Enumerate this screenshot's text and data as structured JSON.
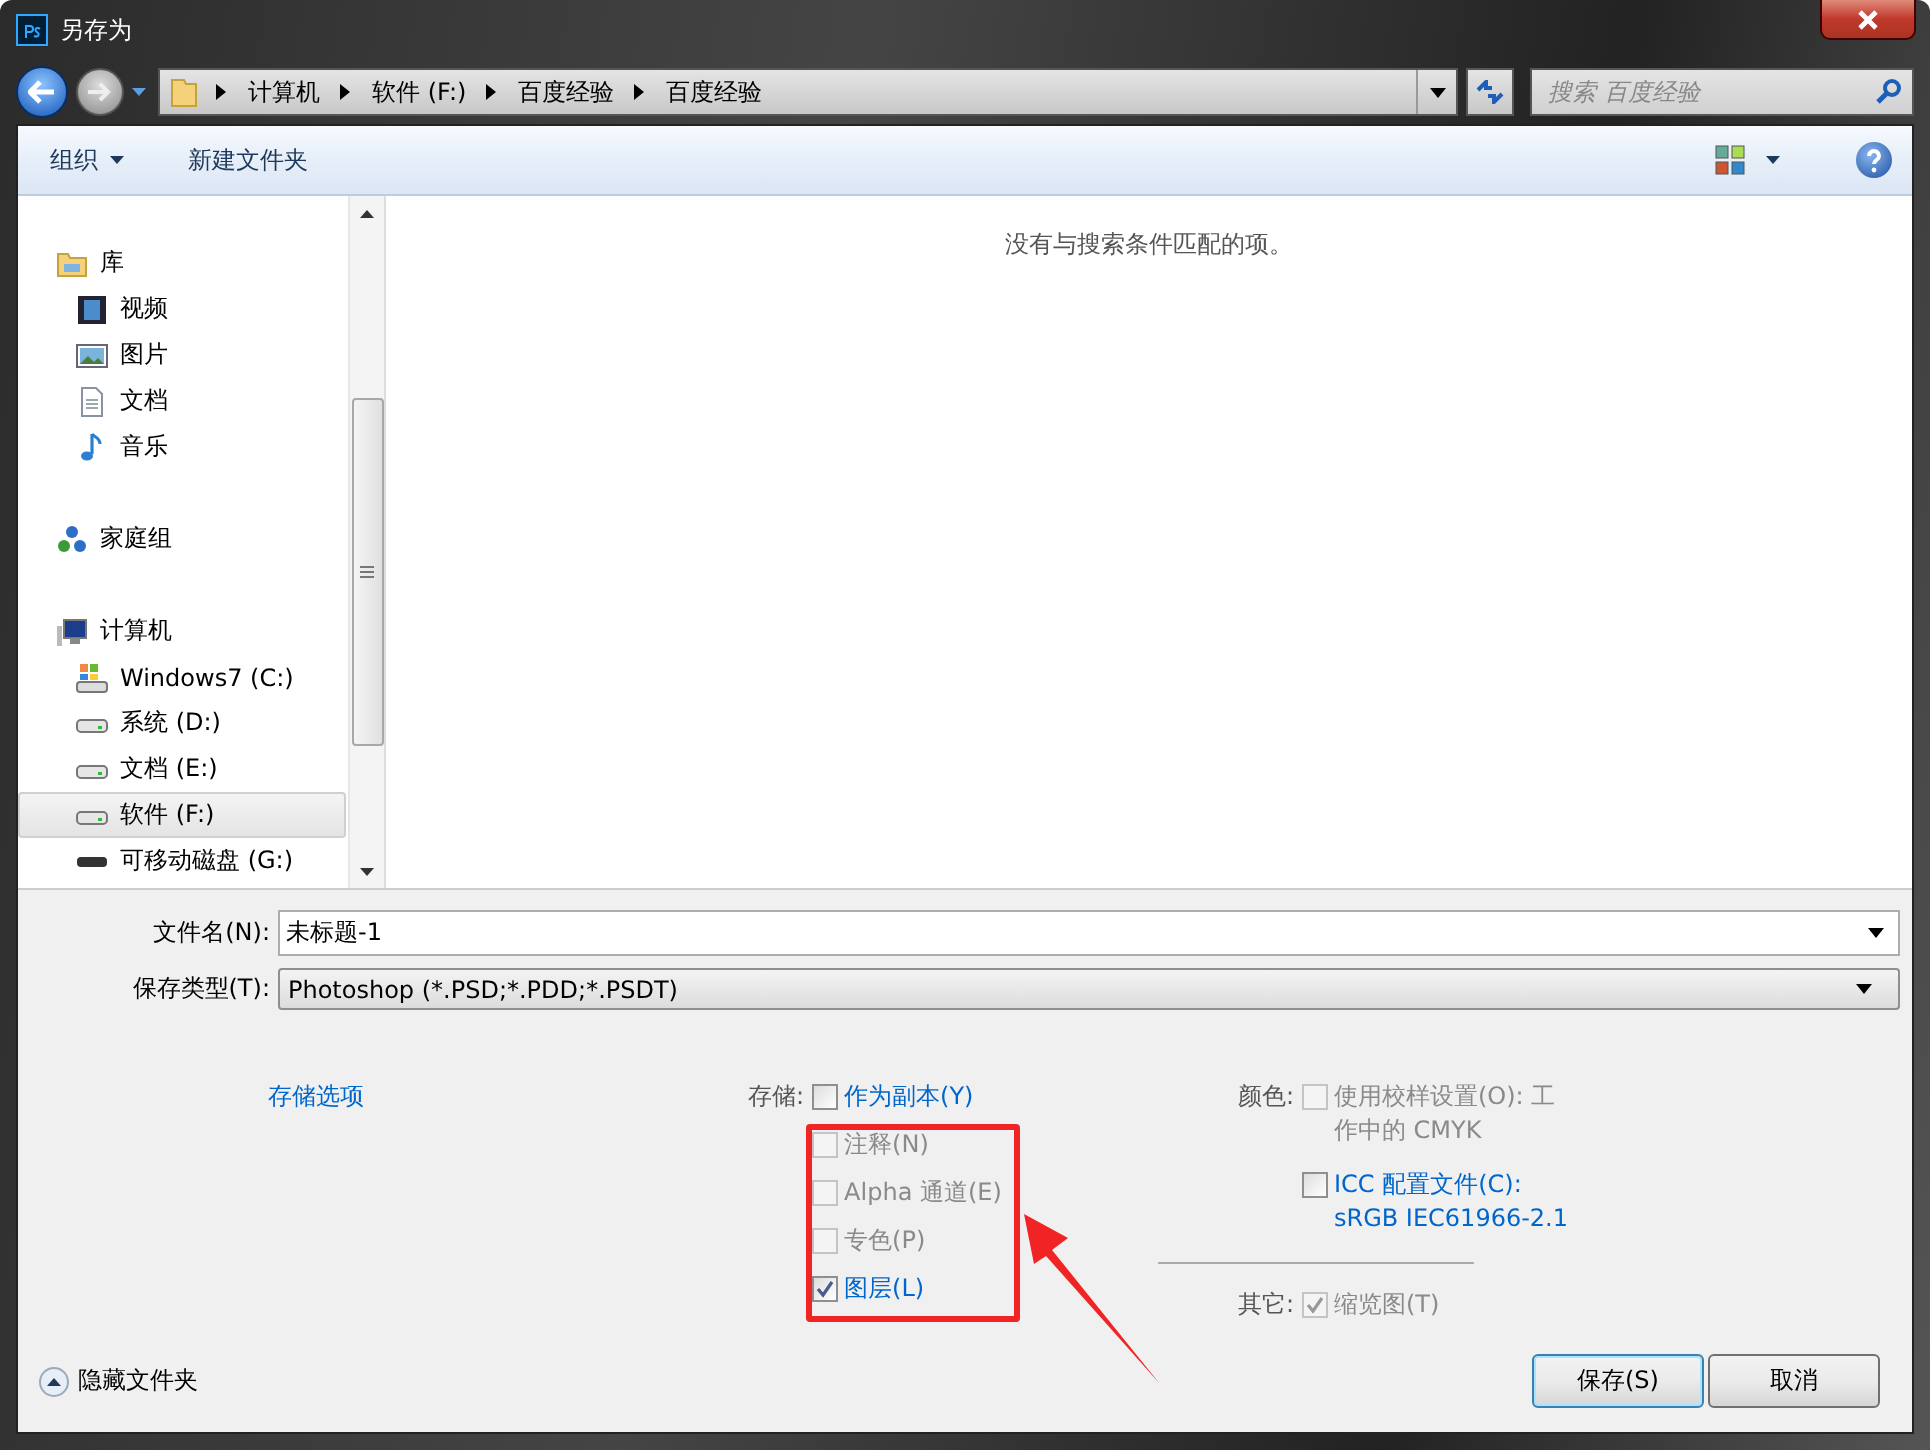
{
  "window": {
    "title": "另存为"
  },
  "breadcrumb": [
    "计算机",
    "软件 (F:)",
    "百度经验",
    "百度经验"
  ],
  "search": {
    "placeholder": "搜索 百度经验"
  },
  "toolbar": {
    "organize": "组织",
    "new_folder": "新建文件夹"
  },
  "sidebar": {
    "items": [
      {
        "label": "库",
        "kind": "library",
        "selected": false,
        "children": [
          {
            "label": "视频",
            "kind": "video",
            "selected": false
          },
          {
            "label": "图片",
            "kind": "pictures",
            "selected": false
          },
          {
            "label": "文档",
            "kind": "document",
            "selected": false
          },
          {
            "label": "音乐",
            "kind": "music",
            "selected": false
          }
        ]
      },
      {
        "label": "家庭组",
        "kind": "homegroup",
        "selected": false
      },
      {
        "label": "计算机",
        "kind": "computer",
        "selected": false,
        "children": [
          {
            "label": "Windows7 (C:)",
            "kind": "system-drive",
            "selected": false
          },
          {
            "label": "系统 (D:)",
            "kind": "drive",
            "selected": false
          },
          {
            "label": "文档 (E:)",
            "kind": "drive",
            "selected": false
          },
          {
            "label": "软件 (F:)",
            "kind": "drive",
            "selected": true
          },
          {
            "label": "可移动磁盘 (G:)",
            "kind": "removable",
            "selected": false
          }
        ]
      }
    ]
  },
  "empty_message": "没有与搜索条件匹配的项。",
  "form": {
    "file_name": {
      "label": "文件名(N):",
      "value": "未标题-1"
    },
    "file_type": {
      "label": "保存类型(T):",
      "value": "Photoshop (*.PSD;*.PDD;*.PSDT)"
    }
  },
  "options": {
    "link": "存储选项",
    "save": {
      "label": "存储:",
      "items": [
        {
          "label": "作为副本(Y)",
          "checked": false,
          "disabled": false
        },
        {
          "label": "注释(N)",
          "checked": false,
          "disabled": true
        },
        {
          "label": "Alpha 通道(E)",
          "checked": false,
          "disabled": true
        },
        {
          "label": "专色(P)",
          "checked": false,
          "disabled": true
        },
        {
          "label": "图层(L)",
          "checked": true,
          "disabled": false
        }
      ]
    },
    "color": {
      "label": "颜色:",
      "items": [
        {
          "label": "使用校样设置(O): 工作中的 CMYK",
          "checked": false,
          "disabled": true
        },
        {
          "label": "ICC 配置文件(C): sRGB IEC61966-2.1",
          "checked": false,
          "disabled": false
        }
      ]
    },
    "other": {
      "label": "其它:",
      "items": [
        {
          "label": "缩览图(T)",
          "checked": true,
          "disabled": true
        }
      ]
    }
  },
  "hide_folders": "隐藏文件夹",
  "buttons": [
    {
      "label": "保存(S)",
      "default": true
    },
    {
      "label": "取消",
      "default": false
    }
  ]
}
